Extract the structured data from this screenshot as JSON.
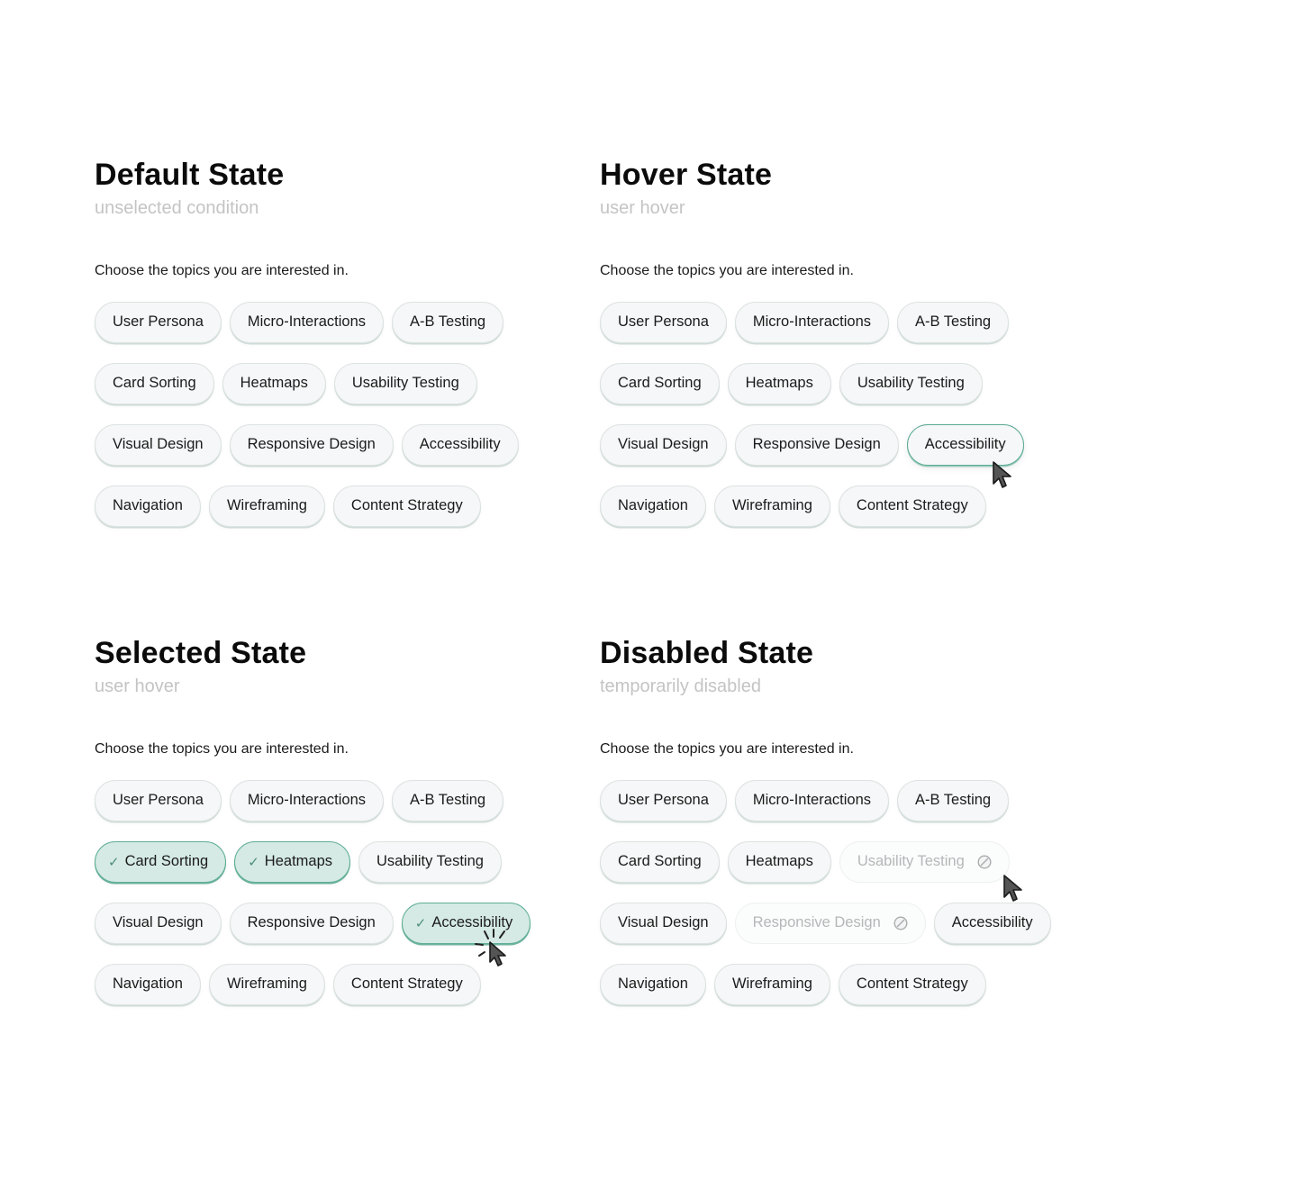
{
  "colors": {
    "accent": "#5fae96",
    "selected_fill": "#d5eae4",
    "chip_fill": "#f6f7f8",
    "subtitle": "#c4c4c4",
    "disabled_text": "#b4b8b8"
  },
  "prompt": "Choose the topics you are interested in.",
  "panels": {
    "default": {
      "title": "Default State",
      "subtitle": "unselected condition",
      "rows": [
        [
          "User Persona",
          "Micro-Interactions",
          "A-B Testing"
        ],
        [
          "Card Sorting",
          "Heatmaps",
          "Usability Testing"
        ],
        [
          "Visual Design",
          "Responsive Design",
          "Accessibility"
        ],
        [
          "Navigation",
          "Wireframing",
          "Content Strategy"
        ]
      ]
    },
    "hover": {
      "title": "Hover State",
      "subtitle": "user hover",
      "hovered": "Accessibility",
      "rows": [
        [
          "User Persona",
          "Micro-Interactions",
          "A-B Testing"
        ],
        [
          "Card Sorting",
          "Heatmaps",
          "Usability Testing"
        ],
        [
          "Visual Design",
          "Responsive Design",
          "Accessibility"
        ],
        [
          "Navigation",
          "Wireframing",
          "Content Strategy"
        ]
      ]
    },
    "selected": {
      "title": "Selected State",
      "subtitle": "user hover",
      "selected_items": [
        "Card Sorting",
        "Heatmaps",
        "Accessibility"
      ],
      "check_icon": "✓",
      "rows": [
        [
          "User Persona",
          "Micro-Interactions",
          "A-B Testing"
        ],
        [
          "Card Sorting",
          "Heatmaps",
          "Usability Testing"
        ],
        [
          "Visual Design",
          "Responsive Design",
          "Accessibility"
        ],
        [
          "Navigation",
          "Wireframing",
          "Content Strategy"
        ]
      ]
    },
    "disabled": {
      "title": "Disabled State",
      "subtitle": "temporarily disabled",
      "disabled_items": [
        "Usability Testing",
        "Responsive Design"
      ],
      "rows": [
        [
          "User Persona",
          "Micro-Interactions",
          "A-B Testing"
        ],
        [
          "Card Sorting",
          "Heatmaps",
          "Usability Testing"
        ],
        [
          "Visual Design",
          "Responsive Design",
          "Accessibility"
        ],
        [
          "Navigation",
          "Wireframing",
          "Content Strategy"
        ]
      ]
    }
  }
}
